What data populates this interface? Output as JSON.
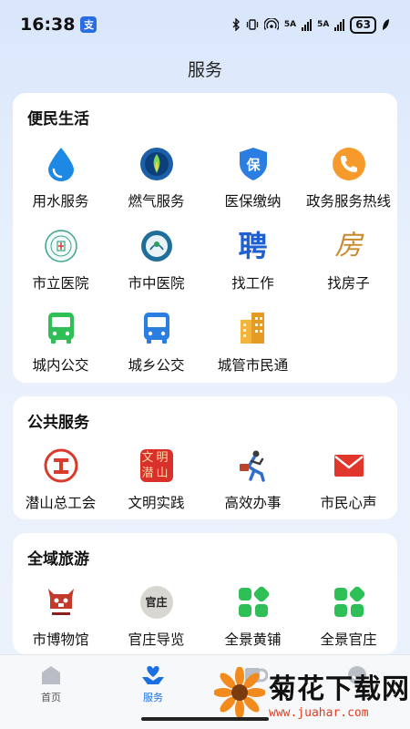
{
  "status_bar": {
    "time": "16:38",
    "app_badge": "支",
    "net_labels": [
      "5A",
      "5A"
    ],
    "battery": "63"
  },
  "page": {
    "title": "服务"
  },
  "sections": [
    {
      "title": "便民生活",
      "items": [
        {
          "label": "用水服务",
          "icon": "water-drop-icon"
        },
        {
          "label": "燃气服务",
          "icon": "gas-flame-icon"
        },
        {
          "label": "医保缴纳",
          "icon": "medical-insurance-shield-icon"
        },
        {
          "label": "政务服务热线",
          "icon": "phone-icon"
        },
        {
          "label": "市立医院",
          "icon": "hospital-logo-icon"
        },
        {
          "label": "市中医院",
          "icon": "tcm-hospital-logo-icon"
        },
        {
          "label": "找工作",
          "icon": "job-pin-icon",
          "glyph": "聘"
        },
        {
          "label": "找房子",
          "icon": "house-glyph-icon",
          "glyph": "房"
        },
        {
          "label": "城内公交",
          "icon": "bus-icon"
        },
        {
          "label": "城乡公交",
          "icon": "bus-icon"
        },
        {
          "label": "城管市民通",
          "icon": "buildings-icon"
        }
      ]
    },
    {
      "title": "公共服务",
      "items": [
        {
          "label": "潜山总工会",
          "icon": "union-logo-icon"
        },
        {
          "label": "文明实践",
          "icon": "civilization-badge-icon",
          "glyph": "文明潜山"
        },
        {
          "label": "高效办事",
          "icon": "running-man-icon"
        },
        {
          "label": "市民心声",
          "icon": "mail-icon"
        }
      ]
    },
    {
      "title": "全域旅游",
      "items": [
        {
          "label": "市博物馆",
          "icon": "museum-logo-icon"
        },
        {
          "label": "官庄导览",
          "icon": "guanzhuang-logo-icon",
          "glyph": "官庄"
        },
        {
          "label": "全景黄铺",
          "icon": "panorama-grid-icon"
        },
        {
          "label": "全景官庄",
          "icon": "panorama-grid-icon"
        }
      ]
    }
  ],
  "tabbar": {
    "tabs": [
      {
        "label": "首页",
        "icon": "home-icon",
        "active": false
      },
      {
        "label": "服务",
        "icon": "heart-hand-icon",
        "active": true
      },
      {
        "label": "",
        "icon": "news-icon",
        "active": false
      },
      {
        "label": "",
        "icon": "profile-icon",
        "active": false
      }
    ]
  },
  "watermark": {
    "text": "菊花下载网",
    "url": "www.juahar.com"
  },
  "colors": {
    "accent": "#1b6fe0",
    "water": "#1e88e5",
    "phone": "#f59a2b",
    "green": "#2fbf57",
    "red": "#d93a2b"
  }
}
